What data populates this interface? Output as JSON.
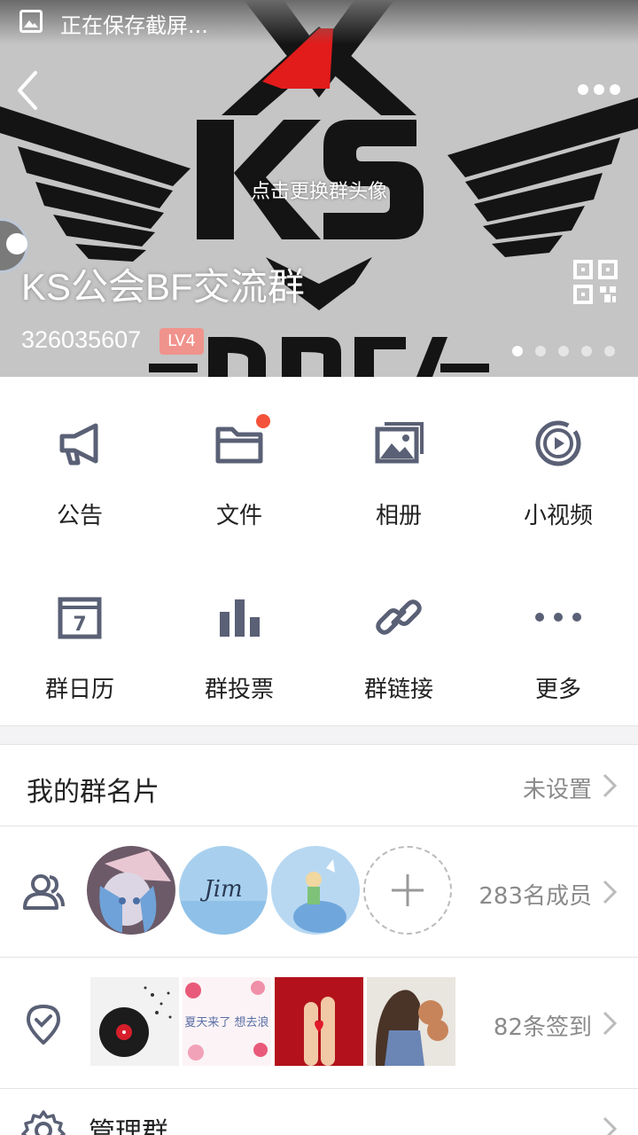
{
  "status_bar": {
    "text": "正在保存截屏..."
  },
  "header": {
    "change_avatar_hint": "点击更换群头像",
    "group_name": "KS公会BF交流群",
    "group_id": "326035607",
    "level": "LV4",
    "banner_art_text": "KS DREAM",
    "carousel_dots": 5,
    "carousel_active": 1
  },
  "features": [
    {
      "label": "公告",
      "icon": "megaphone-icon"
    },
    {
      "label": "文件",
      "icon": "folder-icon",
      "badge": true
    },
    {
      "label": "相册",
      "icon": "photo-album-icon"
    },
    {
      "label": "小视频",
      "icon": "video-play-icon"
    },
    {
      "label": "群日历",
      "icon": "calendar-icon",
      "calendar_day": "7"
    },
    {
      "label": "群投票",
      "icon": "bar-chart-icon"
    },
    {
      "label": "群链接",
      "icon": "link-icon"
    },
    {
      "label": "更多",
      "icon": "more-dots-icon"
    }
  ],
  "my_card": {
    "title": "我的群名片",
    "value": "未设置"
  },
  "members": {
    "count_text": "283名成员",
    "avatar_text": "Jim"
  },
  "checkin": {
    "count_text": "82条签到",
    "thumb_text": "夏天来了 想去浪"
  },
  "manage": {
    "title": "管理群"
  },
  "colors": {
    "icon": "#5a6075",
    "badge_red": "#f4523a",
    "level_badge": "#f0938c"
  }
}
